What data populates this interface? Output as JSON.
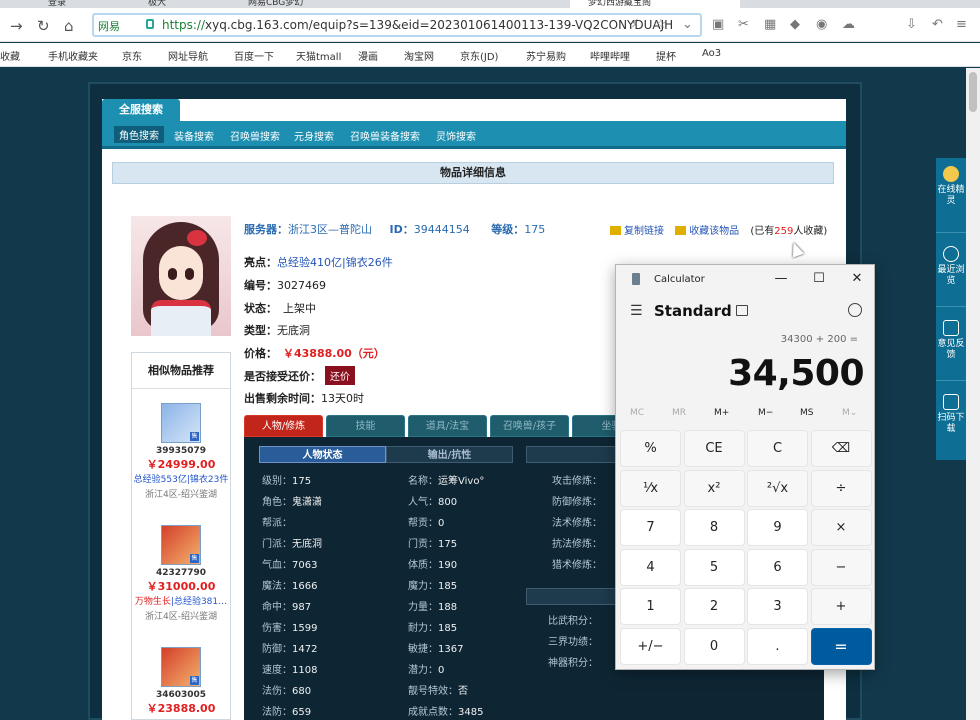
{
  "browser": {
    "tabs": [
      "登录",
      "极大",
      "网易CBG梦幻",
      "梦幻西游藏宝阁"
    ],
    "url_tag": "网易",
    "url_secure": "https://",
    "url_rest": "xyq.cbg.163.com/equip?s=139&eid=202301061400113-139-VQ2CONYDUAJH",
    "bookmarks": [
      "收藏",
      "手机收藏夹",
      "京东",
      "网址导航",
      "百度一下",
      "天猫tmall",
      "漫画",
      "淘宝网",
      "京东(JD)",
      "苏宁易购",
      "哔哩哔哩",
      "提杯",
      "Ao3"
    ]
  },
  "nav": {
    "top_tab": "全服搜索",
    "items": [
      "角色搜索",
      "装备搜索",
      "召唤兽搜索",
      "元身搜索",
      "召唤兽装备搜索",
      "灵饰搜索"
    ]
  },
  "detail_header": "物品详细信息",
  "item": {
    "server_label": "服务器：",
    "server": "浙江3区—普陀山",
    "id_label": "ID：",
    "id": "39444154",
    "level_label": "等级：",
    "level": "175",
    "copy_link": "复制链接",
    "favorite": "收藏该物品",
    "fav_count_pre": "(已有",
    "fav_count": "259",
    "fav_count_post": "人收藏)",
    "highlight_label": "亮点：",
    "highlight": "总经验410亿|锦衣26件",
    "number_label": "编号：",
    "number": "3027469",
    "status_label": "状态：",
    "status": "上架中",
    "type_label": "类型：",
    "type": "无底洞",
    "price_label": "价格：",
    "price": "￥43888.00（元）",
    "counter_label": "是否接受还价：",
    "counter_btn": "还价",
    "remain_label": "出售剩余时间：",
    "remain": "13天0时"
  },
  "similar": {
    "title": "相似物品推荐",
    "items": [
      {
        "id": "39935079",
        "price": "￥24999.00",
        "tag1": "总经验553亿",
        "tag2": "锦衣23件",
        "server": "浙江4区-绍兴鉴湖"
      },
      {
        "id": "42327790",
        "price": "￥31000.00",
        "tag1": "万物生长",
        "tag2": "总经验381…",
        "server": "浙江4区-绍兴鉴湖"
      },
      {
        "id": "34603005",
        "price": "￥23888.00",
        "tag1": "",
        "tag2": "",
        "server": ""
      }
    ]
  },
  "detail_tabs": [
    "人物/修炼",
    "技能",
    "道具/法宝",
    "召唤兽/孩子",
    "坐骑"
  ],
  "panel": {
    "sub_on": "人物状态",
    "sub_off": "输出/抗性",
    "col1": [
      {
        "k": "级别：",
        "v": "175"
      },
      {
        "k": "角色：",
        "v": "鬼潇潇"
      },
      {
        "k": "帮派：",
        "v": ""
      },
      {
        "k": "门派：",
        "v": "无底洞"
      },
      {
        "k": "气血：",
        "v": "7063"
      },
      {
        "k": "魔法：",
        "v": "1666"
      },
      {
        "k": "命中：",
        "v": "987"
      },
      {
        "k": "伤害：",
        "v": "1599"
      },
      {
        "k": "防御：",
        "v": "1472"
      },
      {
        "k": "速度：",
        "v": "1108"
      },
      {
        "k": "法伤：",
        "v": "680"
      },
      {
        "k": "法防：",
        "v": "659"
      }
    ],
    "col2": [
      {
        "k": "名称：",
        "v": "运筹Vivo°"
      },
      {
        "k": "人气：",
        "v": "800"
      },
      {
        "k": "帮贡：",
        "v": "0"
      },
      {
        "k": "门贡：",
        "v": "175"
      },
      {
        "k": "体质：",
        "v": "190"
      },
      {
        "k": "魔力：",
        "v": "185"
      },
      {
        "k": "力量：",
        "v": "188"
      },
      {
        "k": "耐力：",
        "v": "185"
      },
      {
        "k": "敏捷：",
        "v": "1367"
      },
      {
        "k": "潜力：",
        "v": "0"
      },
      {
        "k": "靓号特效：",
        "v": "否"
      },
      {
        "k": "成就点数：",
        "v": "3485"
      }
    ],
    "col3": [
      "攻击修炼：",
      "防御修炼：",
      "法术修炼：",
      "抗法修炼：",
      "猎术修炼："
    ],
    "col3b": [
      "比武积分：",
      "三界功绩：",
      "神器积分："
    ]
  },
  "calculator": {
    "title": "Calculator",
    "mode": "Standard",
    "expression": "34300 + 200 =",
    "result": "34,500",
    "memory": [
      "MC",
      "MR",
      "M+",
      "M−",
      "MS",
      "M⌄"
    ],
    "keys": [
      [
        "%",
        "CE",
        "C",
        "⌫"
      ],
      [
        "¹⁄x",
        "x²",
        "²√x",
        "÷"
      ],
      [
        "7",
        "8",
        "9",
        "×"
      ],
      [
        "4",
        "5",
        "6",
        "−"
      ],
      [
        "1",
        "2",
        "3",
        "+"
      ],
      [
        "+/−",
        "0",
        ".",
        "="
      ]
    ]
  },
  "sidebar": {
    "items": [
      "在线精灵",
      "最近浏览",
      "意见反馈",
      "扫码下载"
    ]
  }
}
